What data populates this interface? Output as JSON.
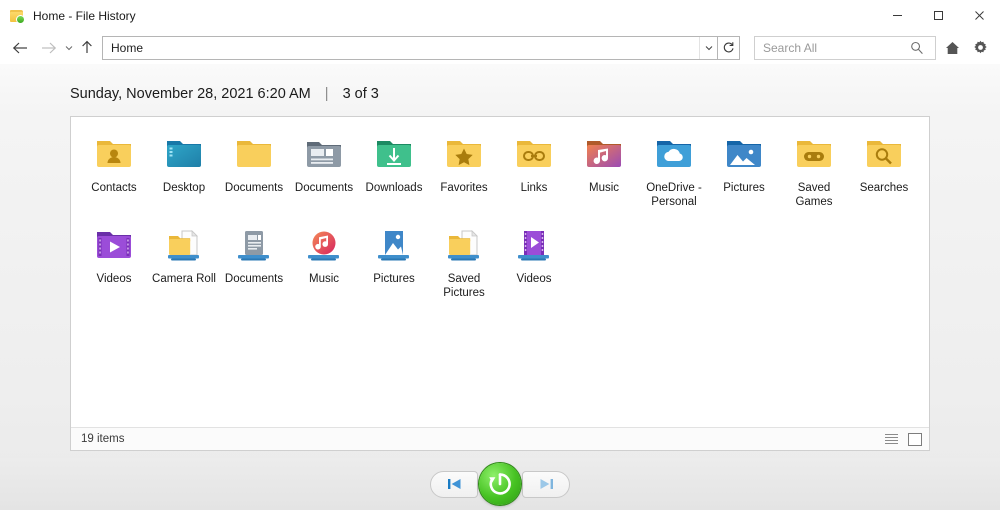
{
  "window": {
    "title": "Home - File History",
    "title_icon": "folder-refresh-icon",
    "controls": {
      "minimize": "minimize-icon",
      "maximize": "maximize-icon",
      "close": "close-icon"
    }
  },
  "navbar": {
    "back": "back-arrow-icon",
    "forward": "forward-arrow-icon",
    "history_dropdown": "chevron-down-icon",
    "up": "up-arrow-icon",
    "address_value": "Home",
    "address_dropdown": "chevron-down-icon",
    "refresh": "refresh-icon",
    "search_placeholder": "Search All",
    "search_value": "",
    "search_icon": "search-icon",
    "home_icon": "home-icon",
    "settings_icon": "gear-icon"
  },
  "header": {
    "timestamp": "Sunday, November 28, 2021 6:20 AM",
    "separator": "|",
    "position": "3 of 3"
  },
  "items": [
    {
      "label": "Contacts",
      "icon": "folder-contacts-icon"
    },
    {
      "label": "Desktop",
      "icon": "folder-desktop-icon"
    },
    {
      "label": "Documents",
      "icon": "folder-plain-icon"
    },
    {
      "label": "Documents",
      "icon": "document-library-icon"
    },
    {
      "label": "Downloads",
      "icon": "folder-downloads-icon"
    },
    {
      "label": "Favorites",
      "icon": "folder-favorites-icon"
    },
    {
      "label": "Links",
      "icon": "folder-links-icon"
    },
    {
      "label": "Music",
      "icon": "folder-music-icon"
    },
    {
      "label": "OneDrive - Personal",
      "icon": "folder-onedrive-icon"
    },
    {
      "label": "Pictures",
      "icon": "folder-pictures-icon"
    },
    {
      "label": "Saved Games",
      "icon": "folder-savedgames-icon"
    },
    {
      "label": "Searches",
      "icon": "folder-searches-icon"
    },
    {
      "label": "Videos",
      "icon": "folder-videos-icon"
    },
    {
      "label": "Camera Roll",
      "icon": "library-folder-icon"
    },
    {
      "label": "Documents",
      "icon": "library-documents-icon"
    },
    {
      "label": "Music",
      "icon": "library-music-icon"
    },
    {
      "label": "Pictures",
      "icon": "library-pictures-icon"
    },
    {
      "label": "Saved Pictures",
      "icon": "library-folder-icon"
    },
    {
      "label": "Videos",
      "icon": "library-videos-icon"
    }
  ],
  "statusbar": {
    "item_count": "19 items",
    "view_details": "details-view-icon",
    "view_large_icons": "large-icons-view-icon"
  },
  "transport": {
    "previous": "previous-version-icon",
    "restore": "restore-icon",
    "next": "next-version-icon"
  },
  "colors": {
    "accent_green": "#46c222",
    "accent_blue": "#1a7cc4",
    "folder_yellow": "#f6c747",
    "window_bg": "#ffffff"
  }
}
